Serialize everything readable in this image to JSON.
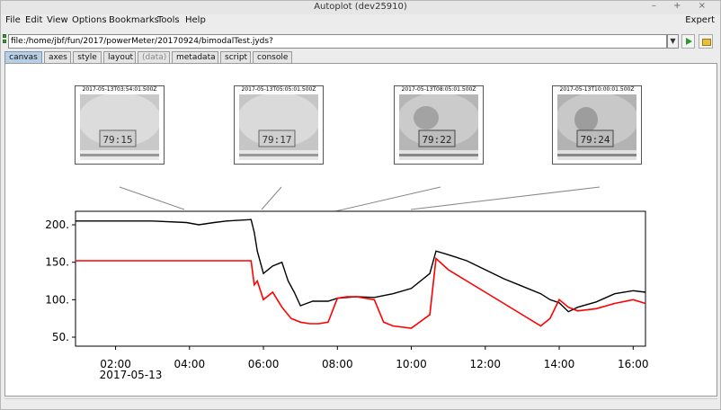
{
  "window": {
    "title": "Autoplot (dev25910)",
    "controls": "– + ×"
  },
  "menubar": {
    "items": [
      "File",
      "Edit",
      "View",
      "Options",
      "Bookmarks",
      "Tools",
      "Help"
    ],
    "expert_label": "Expert"
  },
  "address": {
    "value": "file:/home/jbf/fun/2017/powerMeter/20170924/bimodalTest.jyds?"
  },
  "tabs": [
    {
      "label": "canvas",
      "active": true
    },
    {
      "label": "axes"
    },
    {
      "label": "style"
    },
    {
      "label": "layout"
    },
    {
      "label": "(data)",
      "disabled": true
    },
    {
      "label": "metadata"
    },
    {
      "label": "script"
    },
    {
      "label": "console"
    }
  ],
  "thumbnails": [
    {
      "timestamp": "2017-05-13T03:54:01.500Z",
      "display": "79:15"
    },
    {
      "timestamp": "2017-05-13T05:05:01.500Z",
      "display": "79:17"
    },
    {
      "timestamp": "2017-05-13T08:05:01.500Z",
      "display": "79:22"
    },
    {
      "timestamp": "2017-05-13T10:00:01.500Z",
      "display": "79:24"
    }
  ],
  "chart_data": {
    "type": "line",
    "x_label_date": "2017-05-13",
    "x_ticks": [
      "02:00",
      "04:00",
      "06:00",
      "08:00",
      "10:00",
      "12:00",
      "14:00",
      "16:00"
    ],
    "x_range": [
      "00:55",
      "16:20"
    ],
    "y_ticks": [
      50,
      100,
      150,
      200
    ],
    "ylim": [
      38,
      218
    ],
    "grid": false,
    "series": [
      {
        "color": "#000000",
        "x": [
          "00:55",
          "02:00",
          "03:00",
          "03:55",
          "04:15",
          "04:40",
          "05:00",
          "05:40",
          "05:45",
          "05:50",
          "06:00",
          "06:15",
          "06:30",
          "06:40",
          "06:50",
          "07:00",
          "07:10",
          "07:20",
          "07:30",
          "07:45",
          "08:00",
          "08:30",
          "09:00",
          "09:30",
          "10:00",
          "10:30",
          "10:40",
          "11:00",
          "11:30",
          "12:00",
          "12:30",
          "13:00",
          "13:30",
          "13:45",
          "14:00",
          "14:15",
          "14:30",
          "15:00",
          "15:30",
          "16:00",
          "16:20"
        ],
        "y": [
          205,
          205,
          205,
          203,
          200,
          203,
          205,
          207,
          190,
          165,
          135,
          145,
          150,
          125,
          110,
          92,
          95,
          98,
          98,
          98,
          102,
          104,
          103,
          108,
          115,
          135,
          165,
          160,
          152,
          140,
          128,
          118,
          108,
          100,
          96,
          84,
          90,
          97,
          108,
          112,
          110
        ]
      },
      {
        "color": "#ff0000",
        "x": [
          "00:55",
          "02:00",
          "03:00",
          "04:00",
          "05:00",
          "05:40",
          "05:45",
          "05:50",
          "06:00",
          "06:15",
          "06:30",
          "06:45",
          "07:00",
          "07:15",
          "07:30",
          "07:45",
          "08:00",
          "08:15",
          "08:30",
          "09:00",
          "09:15",
          "09:30",
          "10:00",
          "10:30",
          "10:40",
          "11:00",
          "11:30",
          "12:00",
          "12:30",
          "13:00",
          "13:30",
          "13:45",
          "14:00",
          "14:15",
          "14:30",
          "15:00",
          "15:30",
          "16:00",
          "16:20"
        ],
        "y": [
          152,
          152,
          152,
          152,
          152,
          152,
          120,
          125,
          100,
          110,
          90,
          75,
          70,
          68,
          68,
          70,
          102,
          104,
          104,
          100,
          70,
          65,
          62,
          80,
          155,
          140,
          125,
          110,
          95,
          80,
          65,
          75,
          100,
          90,
          85,
          88,
          95,
          100,
          95
        ]
      }
    ]
  }
}
